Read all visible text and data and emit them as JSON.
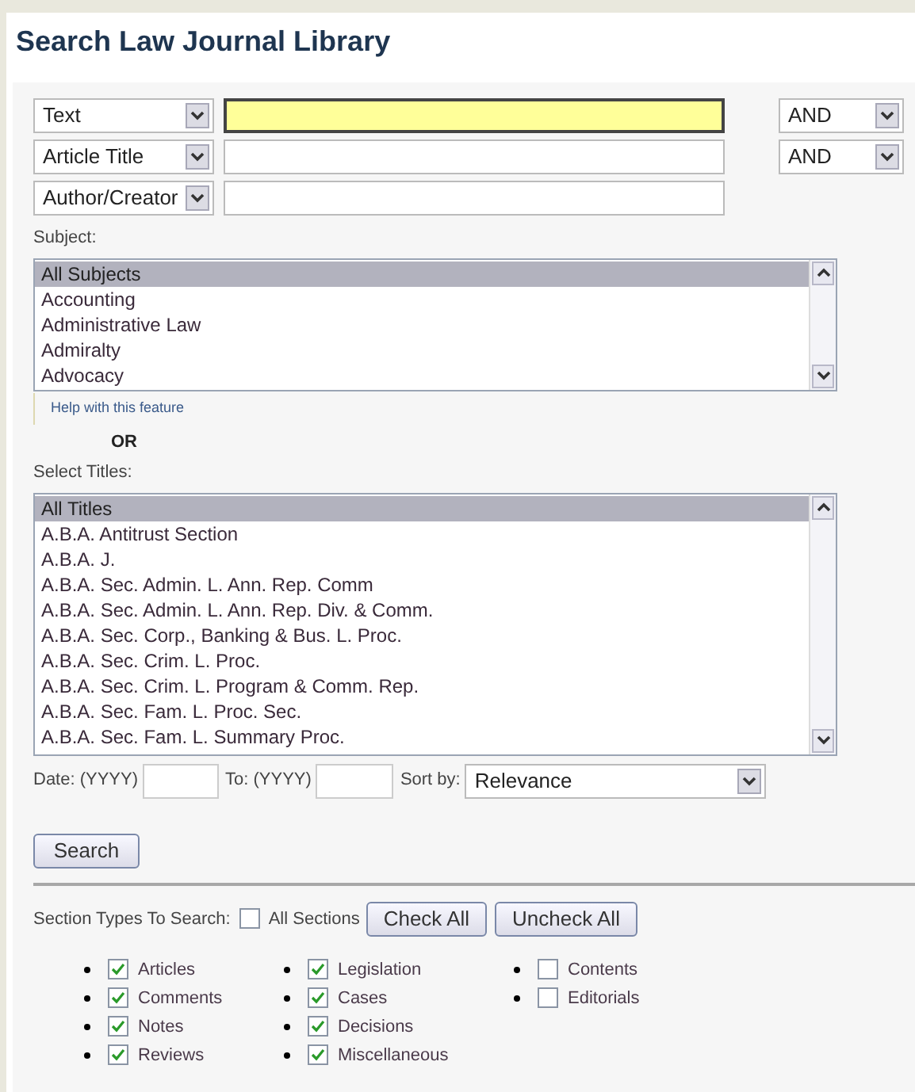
{
  "title": "Search Law Journal Library",
  "search_rows": [
    {
      "field": "Text",
      "focused": true,
      "operator": "AND"
    },
    {
      "field": "Article Title",
      "focused": false,
      "operator": "AND"
    },
    {
      "field": "Author/Creator",
      "focused": false
    }
  ],
  "subject": {
    "label": "Subject:",
    "items": [
      {
        "label": "All Subjects",
        "selected": true
      },
      {
        "label": "Accounting",
        "selected": false
      },
      {
        "label": "Administrative Law",
        "selected": false
      },
      {
        "label": "Admiralty",
        "selected": false
      },
      {
        "label": "Advocacy",
        "selected": false
      }
    ]
  },
  "help_link": "Help with this feature",
  "or_label": "OR",
  "titles": {
    "label": "Select Titles:",
    "items": [
      {
        "label": "All Titles",
        "selected": true
      },
      {
        "label": "A.B.A. Antitrust Section",
        "selected": false
      },
      {
        "label": "A.B.A. J.",
        "selected": false
      },
      {
        "label": "A.B.A. Sec. Admin. L. Ann. Rep. Comm",
        "selected": false
      },
      {
        "label": "A.B.A. Sec. Admin. L. Ann. Rep. Div. & Comm.",
        "selected": false
      },
      {
        "label": "A.B.A. Sec. Corp., Banking & Bus. L. Proc.",
        "selected": false
      },
      {
        "label": "A.B.A. Sec. Crim. L. Proc.",
        "selected": false
      },
      {
        "label": "A.B.A. Sec. Crim. L. Program & Comm. Rep.",
        "selected": false
      },
      {
        "label": "A.B.A. Sec. Fam. L. Proc. Sec.",
        "selected": false
      },
      {
        "label": "A.B.A. Sec. Fam. L. Summary Proc.",
        "selected": false
      }
    ]
  },
  "date": {
    "from_label": "Date: (YYYY)",
    "to_label": "To: (YYYY)",
    "sort_label": "Sort by:",
    "sort_value": "Relevance"
  },
  "search_button": "Search",
  "sections": {
    "label": "Section Types To Search:",
    "all_label": "All Sections",
    "all_checked": false,
    "check_all": "Check All",
    "uncheck_all": "Uncheck All",
    "columns": [
      [
        {
          "label": "Articles",
          "checked": true
        },
        {
          "label": "Comments",
          "checked": true
        },
        {
          "label": "Notes",
          "checked": true
        },
        {
          "label": "Reviews",
          "checked": true
        }
      ],
      [
        {
          "label": "Legislation",
          "checked": true
        },
        {
          "label": "Cases",
          "checked": true
        },
        {
          "label": "Decisions",
          "checked": true
        },
        {
          "label": "Miscellaneous",
          "checked": true
        }
      ],
      [
        {
          "label": "Contents",
          "checked": false
        },
        {
          "label": "Editorials",
          "checked": false
        }
      ]
    ]
  }
}
